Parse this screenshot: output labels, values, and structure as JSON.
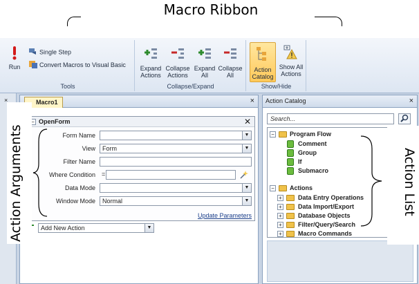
{
  "callouts": {
    "macro_ribbon": "Macro Ribbon",
    "action_arguments": "Action Arguments",
    "action_list": "Action List"
  },
  "ribbon": {
    "tools": {
      "label": "Tools",
      "run": "Run",
      "single_step": "Single Step",
      "convert": "Convert Macros to Visual Basic"
    },
    "collapse_expand": {
      "label": "Collapse/Expand",
      "expand_actions": [
        "Expand",
        "Actions"
      ],
      "collapse_actions": [
        "Collapse",
        "Actions"
      ],
      "expand_all": [
        "Expand",
        "All"
      ],
      "collapse_all": [
        "Collapse",
        "All"
      ]
    },
    "show_hide": {
      "label": "Show/Hide",
      "action_catalog": [
        "Action",
        "Catalog"
      ],
      "show_all_actions": [
        "Show All",
        "Actions"
      ]
    }
  },
  "nav_close": "×",
  "document": {
    "tab": "Macro1",
    "close": "×",
    "action": {
      "name": "OpenForm",
      "toggle": "−",
      "close": "✕",
      "args": [
        {
          "label": "Form Name",
          "value": "",
          "dropdown": true
        },
        {
          "label": "View",
          "value": "Form",
          "dropdown": true
        },
        {
          "label": "Filter Name",
          "value": "",
          "dropdown": false
        },
        {
          "label": "Where Condition",
          "value": "=",
          "dropdown": false
        },
        {
          "label": "Data Mode",
          "value": "",
          "dropdown": true
        },
        {
          "label": "Window Mode",
          "value": "Normal",
          "dropdown": true
        }
      ],
      "update_parameters": "Update Parameters"
    },
    "add_new_action": "Add New Action"
  },
  "catalog": {
    "title": "Action Catalog",
    "close": "×",
    "search_placeholder": "Search...",
    "tree": {
      "program_flow": {
        "label": "Program Flow",
        "toggle": "−",
        "items": [
          "Comment",
          "Group",
          "If",
          "Submacro"
        ]
      },
      "actions": {
        "label": "Actions",
        "toggle": "−",
        "items": [
          "Data Entry Operations",
          "Data Import/Export",
          "Database Objects",
          "Filter/Query/Search",
          "Macro Commands"
        ],
        "toggle_child": "+"
      }
    }
  },
  "colors": {
    "ribbon_top": "#f3f6fb",
    "ribbon_bottom": "#dde6f2",
    "active_button": "#ffc95a",
    "workspace": "#c8d4e4",
    "link": "#1a3e8a"
  }
}
